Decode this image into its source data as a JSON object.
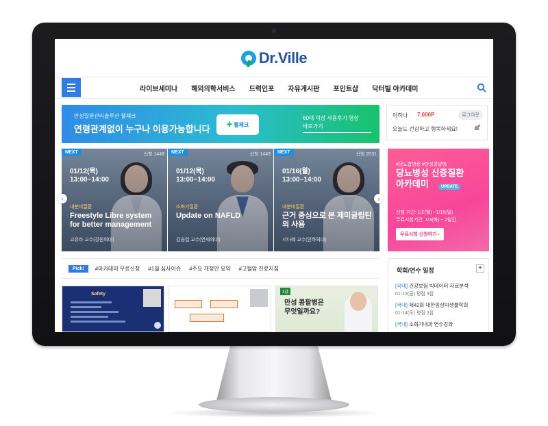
{
  "brand": {
    "name": "Dr.Ville",
    "accent": "#2554a4",
    "blue": "#2f7de1"
  },
  "nav": {
    "items": [
      "라이브세미나",
      "해외의학서비스",
      "드럭인포",
      "자유게시판",
      "포인트샵",
      "닥터빌 아카데미"
    ]
  },
  "banner": {
    "subtitle": "만성질환관리솔루션 웰체크",
    "headline": "연령관계없이 누구나 이용가능합니다",
    "badge": "웰체크",
    "right_line1": "60대 이상 사용후기 영상",
    "right_line2": "바로가기"
  },
  "user": {
    "name": "이하나",
    "points": "7,000P",
    "logout": "로그아웃",
    "greeting": "오늘도 건강하고 행복하세요!"
  },
  "lectures": [
    {
      "badge": "NEXT",
      "apply": "신청 1448",
      "date": "01/12(목)",
      "time": "13:00~14:00",
      "category": "내분비질환",
      "title": "Freestyle Libre system for better management",
      "professor": "고유라 교수(강원의대)"
    },
    {
      "badge": "NEXT",
      "apply": "신청 1449",
      "date": "01/12(목)",
      "time": "13:00~14:00",
      "category": "소화기질환",
      "title": "Update on NAFLD",
      "professor": "김승업 교수(연세의대)"
    },
    {
      "badge": "NEXT",
      "apply": "신청 2031",
      "date": "01/16(월)",
      "time": "13:00~14:00",
      "category": "내분비질환",
      "title": "근거 중심으로 본 제미글립틴의 사용",
      "professor": "서다혜 교수(인하의대)"
    }
  ],
  "promo": {
    "tags": "#당뇨합병증 #만성콩팥병",
    "title_line1": "당뇨병성 신증질환",
    "title_line2": "아카데미",
    "update": "UPDATE",
    "date_line1": "신청 기간: 1/2(월) ~1/15(일)",
    "date_line2": "무료시청기간: 1/3(화) ~ 2달간",
    "button": "무료시청 신청하기 ›"
  },
  "pick": {
    "badge": "Pick!",
    "tags": [
      "#아카데미 무료신청",
      "#1월 심사이슈",
      "#주요 개정안 요약",
      "#고혈압 진료지침"
    ]
  },
  "thumbnails": [
    {
      "slide_title": "Safety"
    },
    {
      "slide_title": ""
    },
    {
      "chip": "1강",
      "headline_line1": "만성 콩팥병은",
      "headline_line2": "무엇일까요?"
    }
  ],
  "schedule": {
    "title": "학회/연수 일정",
    "plus": "+",
    "items": [
      {
        "tag": "[국내]",
        "name": "건강보험 빅데이터 자료분석",
        "date": "01-13(금) 평점 3점"
      },
      {
        "tag": "[국내]",
        "name": "제42회 대한임상미생물학회",
        "date": "01-14(토) 평점 3점"
      },
      {
        "tag": "[국내]",
        "name": "소화기내과 연수강좌",
        "date": ""
      }
    ]
  }
}
